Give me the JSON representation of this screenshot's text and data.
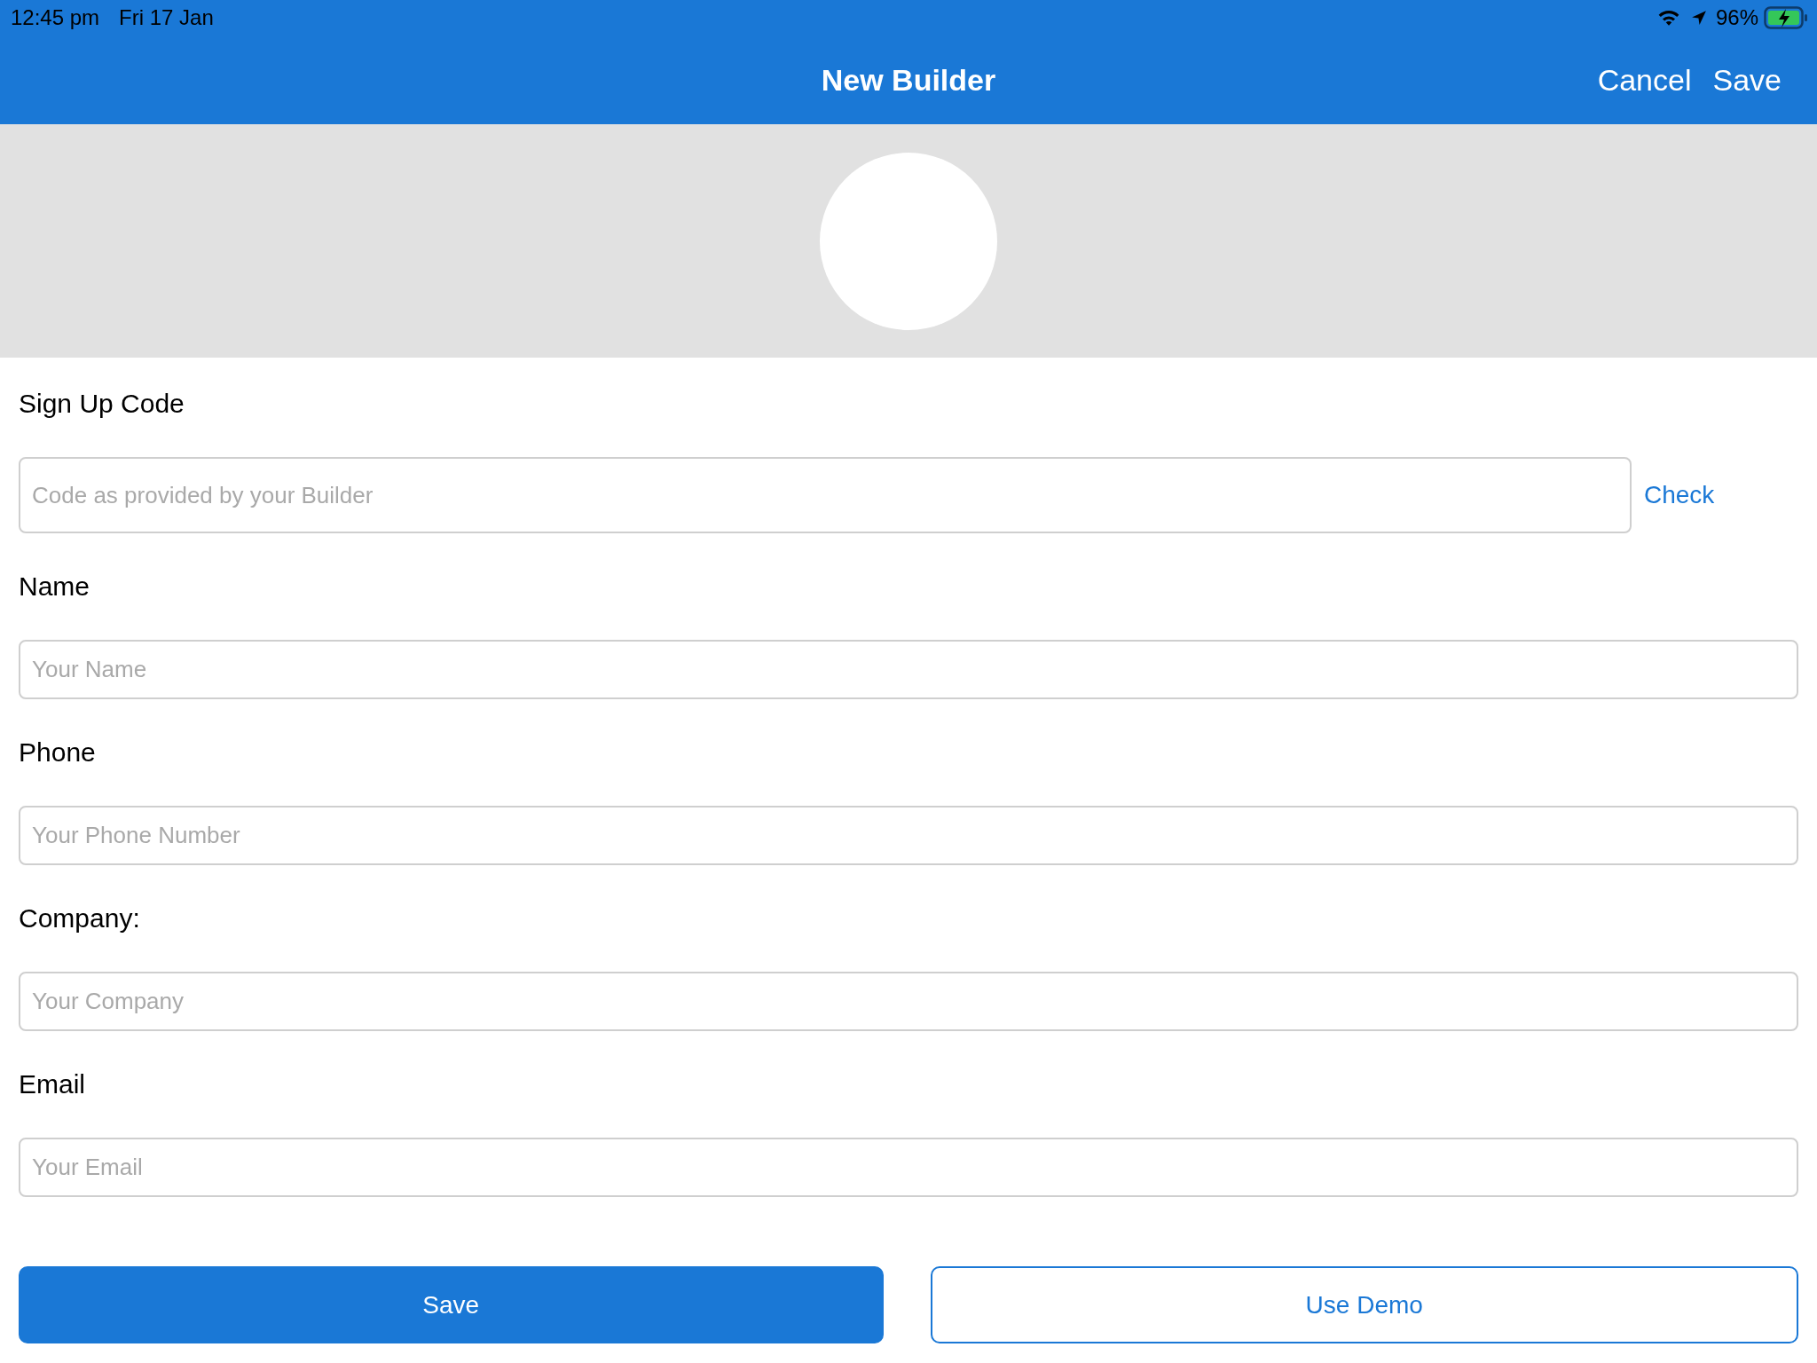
{
  "status_bar": {
    "time": "12:45 pm",
    "date": "Fri 17 Jan",
    "battery": "96%"
  },
  "nav_bar": {
    "title": "New Builder",
    "actions": [
      "Cancel",
      "Save"
    ]
  },
  "fields": [
    {
      "kind": "code",
      "label": "Sign Up Code",
      "placeholder": "Code as provided by your Builder",
      "action": "Check"
    },
    {
      "kind": "text",
      "label": "Name",
      "placeholder": "Your Name"
    },
    {
      "kind": "text",
      "label": "Phone",
      "placeholder": "Your Phone Number"
    },
    {
      "kind": "text",
      "label": "Company:",
      "placeholder": "Your Company"
    },
    {
      "kind": "text",
      "label": "Email",
      "placeholder": "Your Email"
    }
  ],
  "buttons": [
    {
      "kind": "primary",
      "label": "Save"
    },
    {
      "kind": "outline",
      "label": "Use Demo"
    }
  ]
}
